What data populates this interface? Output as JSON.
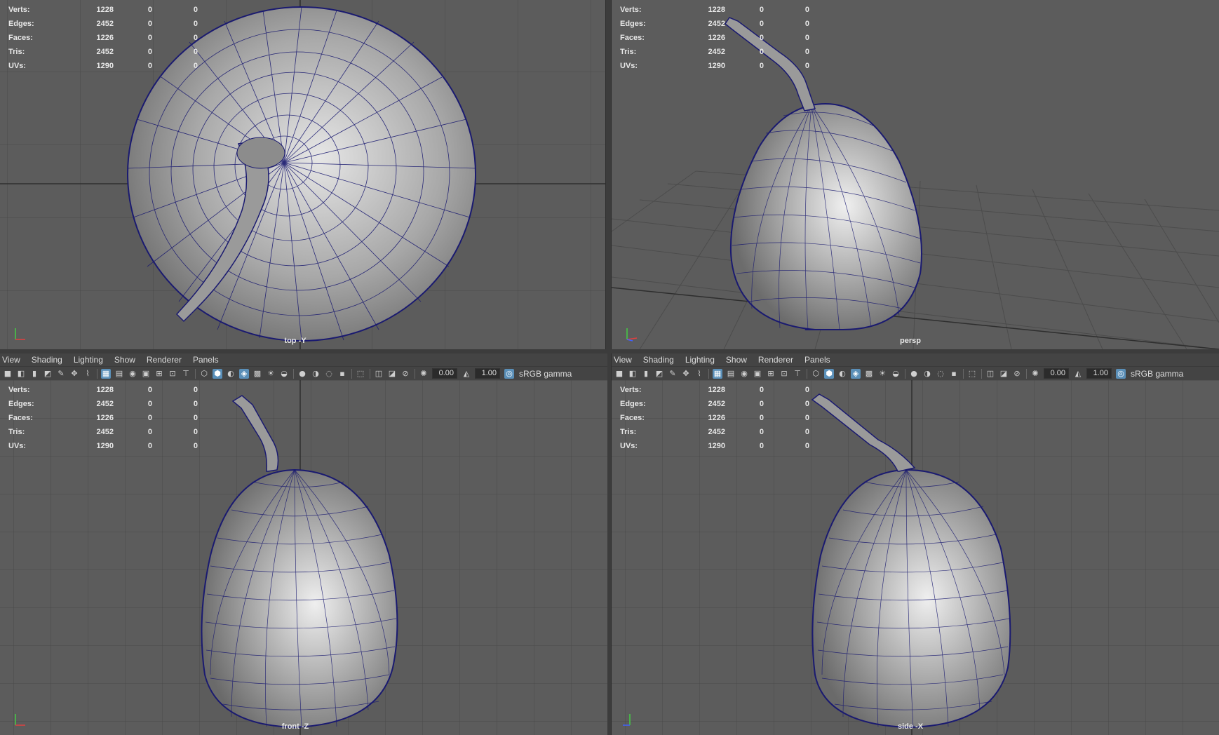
{
  "stats": {
    "rows": [
      {
        "label": "Verts:",
        "v1": "1228",
        "v2": "0",
        "v3": "0"
      },
      {
        "label": "Edges:",
        "v1": "2452",
        "v2": "0",
        "v3": "0"
      },
      {
        "label": "Faces:",
        "v1": "1226",
        "v2": "0",
        "v3": "0"
      },
      {
        "label": "Tris:",
        "v1": "2452",
        "v2": "0",
        "v3": "0"
      },
      {
        "label": "UVs:",
        "v1": "1290",
        "v2": "0",
        "v3": "0"
      }
    ]
  },
  "viewports": {
    "top_left": {
      "camera": "top -Y"
    },
    "top_right": {
      "camera": "persp"
    },
    "bottom_left": {
      "camera": "front -Z"
    },
    "bottom_right": {
      "camera": "side -X"
    }
  },
  "menu": {
    "view": "View",
    "shading": "Shading",
    "lighting": "Lighting",
    "show": "Show",
    "renderer": "Renderer",
    "panels": "Panels"
  },
  "toolbar": {
    "exposure": "0.00",
    "gamma": "1.00",
    "color_space": "sRGB gamma"
  },
  "icons": [
    "camera-icon",
    "grid-icon",
    "wireframe-icon",
    "smooth-shade-icon",
    "isolate-icon",
    "xray-icon",
    "exposure-icon",
    "gamma-icon",
    "color-management-icon"
  ],
  "colors": {
    "viewport_bg": "#5c5c5c",
    "grid_line": "#4a4a4a",
    "grid_axis": "#2e2e2e",
    "mesh_wire": "#1a1a70",
    "accent": "#5a8fb8"
  }
}
